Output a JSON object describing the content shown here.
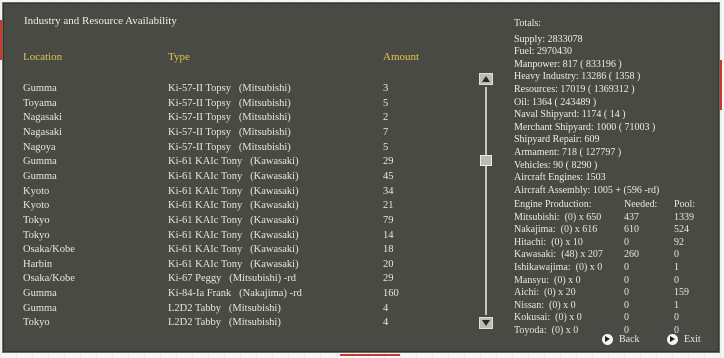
{
  "title": "Industry and Resource Availability",
  "headers": {
    "location": "Location",
    "type": "Type",
    "amount": "Amount"
  },
  "rows": [
    {
      "location": "Gumma",
      "type": "Ki-57-II Topsy   (Mitsubishi)",
      "amount": "3"
    },
    {
      "location": "Toyama",
      "type": "Ki-57-II Topsy   (Mitsubishi)",
      "amount": "5"
    },
    {
      "location": "Nagasaki",
      "type": "Ki-57-II Topsy   (Mitsubishi)",
      "amount": "2"
    },
    {
      "location": "Nagasaki",
      "type": "Ki-57-II Topsy   (Mitsubishi)",
      "amount": "7"
    },
    {
      "location": "Nagoya",
      "type": "Ki-57-II Topsy   (Mitsubishi)",
      "amount": "5"
    },
    {
      "location": "Gumma",
      "type": "Ki-61 KAIc Tony   (Kawasaki)",
      "amount": "29"
    },
    {
      "location": "Gumma",
      "type": "Ki-61 KAIc Tony   (Kawasaki)",
      "amount": "45"
    },
    {
      "location": "Kyoto",
      "type": "Ki-61 KAIc Tony   (Kawasaki)",
      "amount": "34"
    },
    {
      "location": "Kyoto",
      "type": "Ki-61 KAIc Tony   (Kawasaki)",
      "amount": "21"
    },
    {
      "location": "Tokyo",
      "type": "Ki-61 KAIc Tony   (Kawasaki)",
      "amount": "79"
    },
    {
      "location": "Tokyo",
      "type": "Ki-61 KAIc Tony   (Kawasaki)",
      "amount": "14"
    },
    {
      "location": "Osaka/Kobe",
      "type": "Ki-61 KAIc Tony   (Kawasaki)",
      "amount": "18"
    },
    {
      "location": "Harbin",
      "type": "Ki-61 KAIc Tony   (Kawasaki)",
      "amount": "20"
    },
    {
      "location": "Osaka/Kobe",
      "type": "Ki-67 Peggy   (Mitsubishi) -rd",
      "amount": "29"
    },
    {
      "location": "Gumma",
      "type": "Ki-84-Ia Frank   (Nakajima) -rd",
      "amount": "160"
    },
    {
      "location": "Gumma",
      "type": "L2D2 Tabby   (Mitsubishi)",
      "amount": "4"
    },
    {
      "location": "Tokyo",
      "type": "L2D2 Tabby   (Mitsubishi)",
      "amount": "4"
    }
  ],
  "totals": [
    "Totals:",
    "Supply: 2833078",
    "Fuel: 2970430",
    "Manpower: 817 ( 833196 )",
    "Heavy Industry: 13286 ( 1358 )",
    "Resources: 17019 ( 1369312 )",
    "Oil: 1364 ( 243489 )",
    "Naval Shipyard: 1174 ( 14 )",
    "Merchant Shipyard: 1000 ( 71003 )",
    "Shipyard Repair: 609",
    "Armament: 718 ( 127797 )",
    "Vehicles: 90 ( 8290 )",
    "Aircraft Engines: 1503",
    "Aircraft Assembly: 1005 + (596 -rd)"
  ],
  "engine_headers": {
    "name": "Engine Production:",
    "needed": "Needed:",
    "pool": "Pool:"
  },
  "engines": [
    {
      "name": "Mitsubishi:  (0) x 650",
      "needed": "437",
      "pool": "1339"
    },
    {
      "name": "Nakajima:  (0) x 616",
      "needed": "610",
      "pool": "524"
    },
    {
      "name": "Hitachi:  (0) x 10",
      "needed": "0",
      "pool": "92"
    },
    {
      "name": "Kawasaki:  (48) x 207",
      "needed": "260",
      "pool": "0"
    },
    {
      "name": "Ishikawajima:  (0) x 0",
      "needed": "0",
      "pool": "1"
    },
    {
      "name": "Mansyu:  (0) x 0",
      "needed": "0",
      "pool": "0"
    },
    {
      "name": "Aichi:  (0) x 20",
      "needed": "0",
      "pool": "159"
    },
    {
      "name": "Nissan:  (0) x 0",
      "needed": "0",
      "pool": "1"
    },
    {
      "name": "Kokusai:  (0) x 0",
      "needed": "0",
      "pool": "0"
    },
    {
      "name": "Toyoda:  (0) x 0",
      "needed": "0",
      "pool": "0"
    }
  ],
  "buttons": {
    "back": "Back",
    "exit": "Exit"
  },
  "colors": {
    "header": "#e3c64a",
    "panel": "#4a4a44"
  }
}
